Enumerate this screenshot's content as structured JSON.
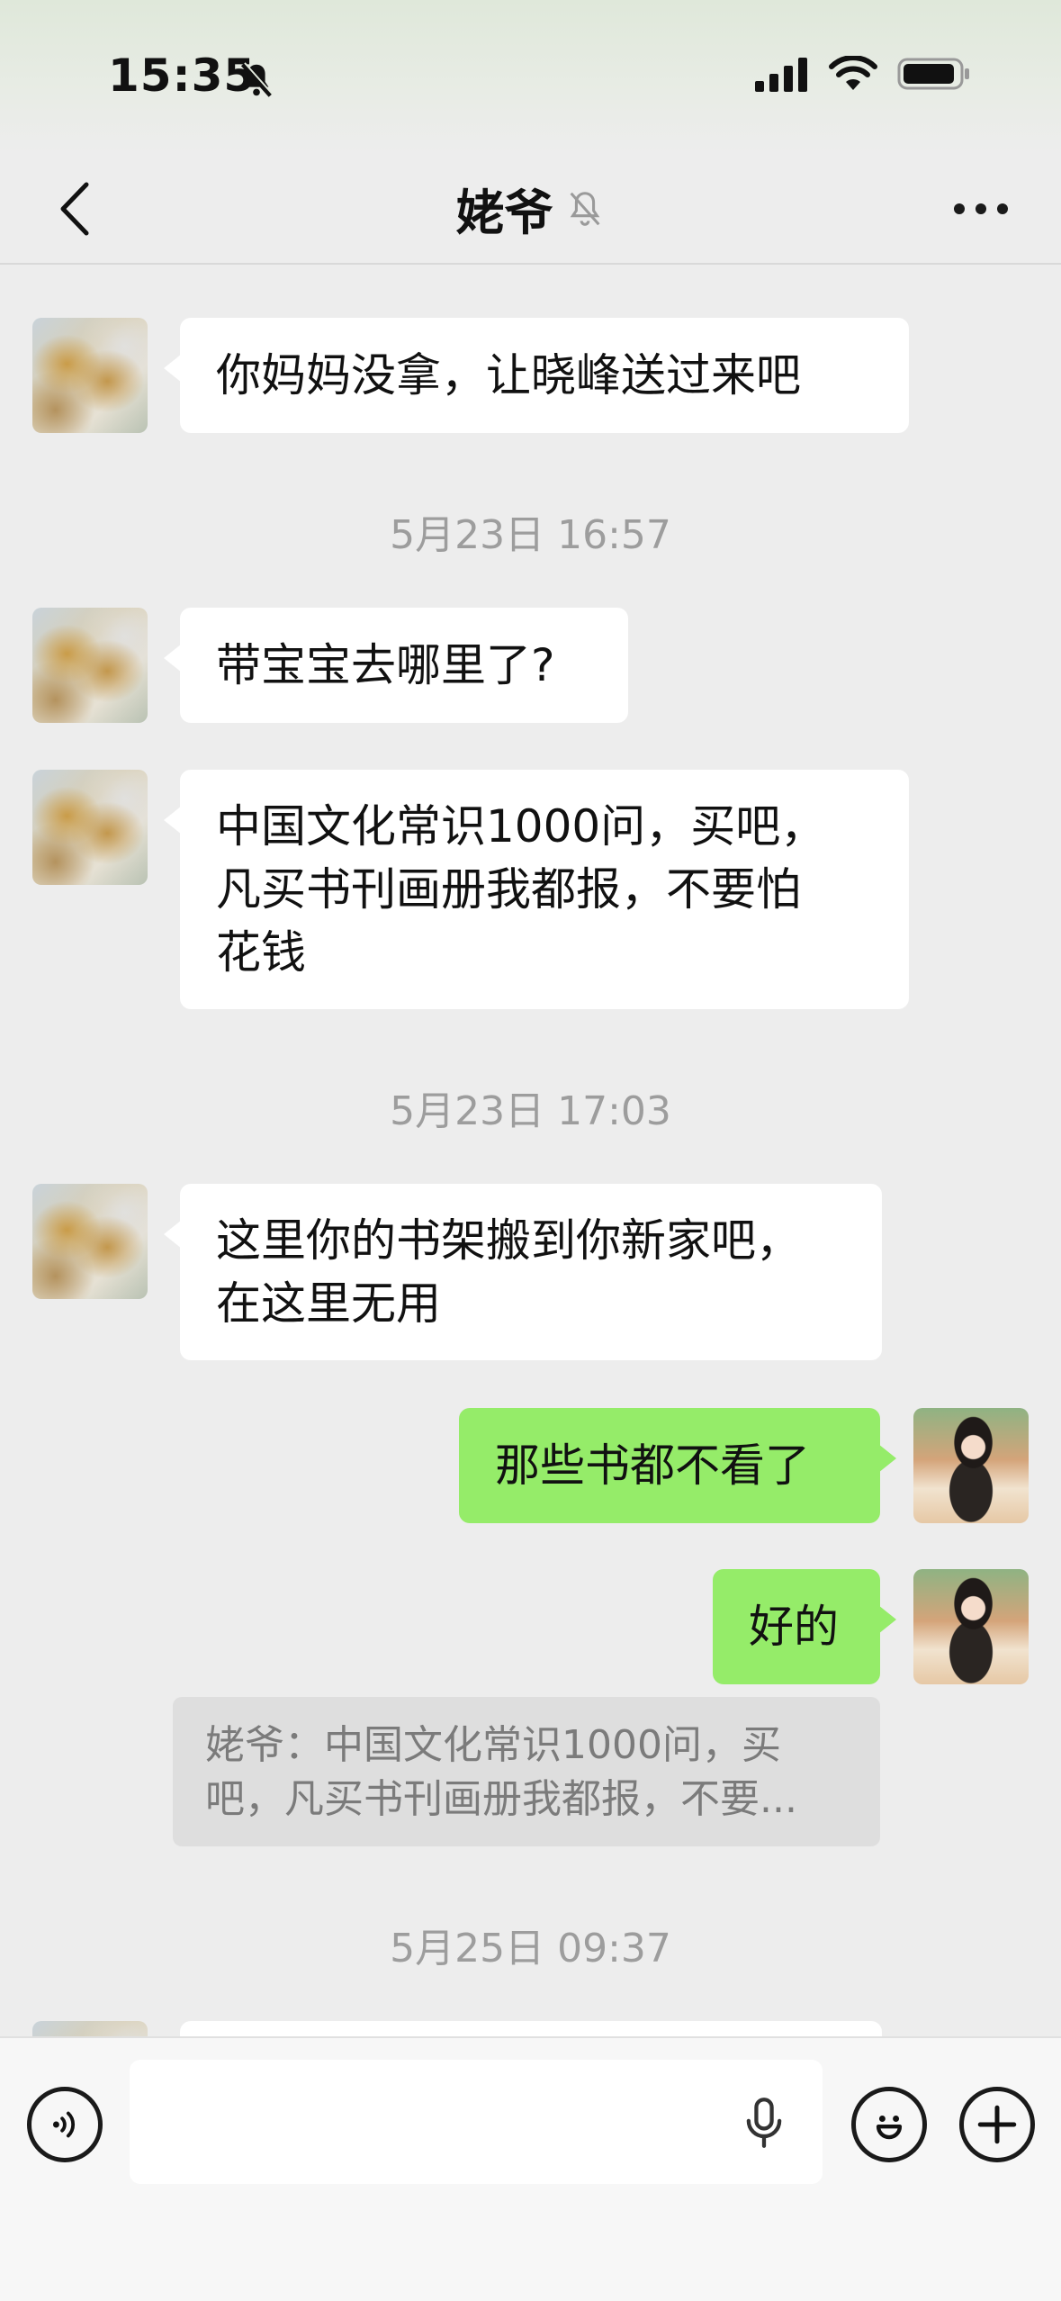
{
  "status_bar": {
    "time": "15:35",
    "icons": [
      "mute-bell-icon",
      "signal-icon",
      "wifi-icon",
      "battery-icon"
    ]
  },
  "nav": {
    "title": "姥爷",
    "back_icon": "chevron-left-icon",
    "mute_icon": "bell-muted-icon",
    "more_icon": "more-dots-icon"
  },
  "messages": [
    {
      "side": "left",
      "text": "你妈妈没拿，让晓峰送过来吧"
    },
    {
      "type": "time",
      "text": "5月23日 16:57"
    },
    {
      "side": "left",
      "text": "带宝宝去哪里了?"
    },
    {
      "side": "left",
      "lines": [
        "中国文化常识1000问，买吧，",
        "凡买书刊画册我都报，不要怕",
        "花钱"
      ]
    },
    {
      "type": "time",
      "text": "5月23日 17:03"
    },
    {
      "side": "left",
      "lines": [
        "这里你的书架搬到你新家吧，",
        "在这里无用"
      ]
    },
    {
      "side": "right",
      "text": "那些书都不看了"
    },
    {
      "side": "right",
      "text": "好的"
    },
    {
      "type": "quote",
      "lines": [
        "姥爷：中国文化常识1000问，买",
        "吧，凡买书刊画册我都报，不要..."
      ]
    },
    {
      "type": "time",
      "text": "5月25日 09:37"
    }
  ],
  "input_bar": {
    "voice_icon": "voice-icon",
    "mic_icon": "mic-icon",
    "emoji_icon": "emoji-icon",
    "plus_icon": "plus-icon",
    "value": ""
  },
  "colors": {
    "background": "#ededed",
    "bubble_left": "#ffffff",
    "bubble_right": "#95ec69",
    "timestamp": "#9d9d9d"
  }
}
